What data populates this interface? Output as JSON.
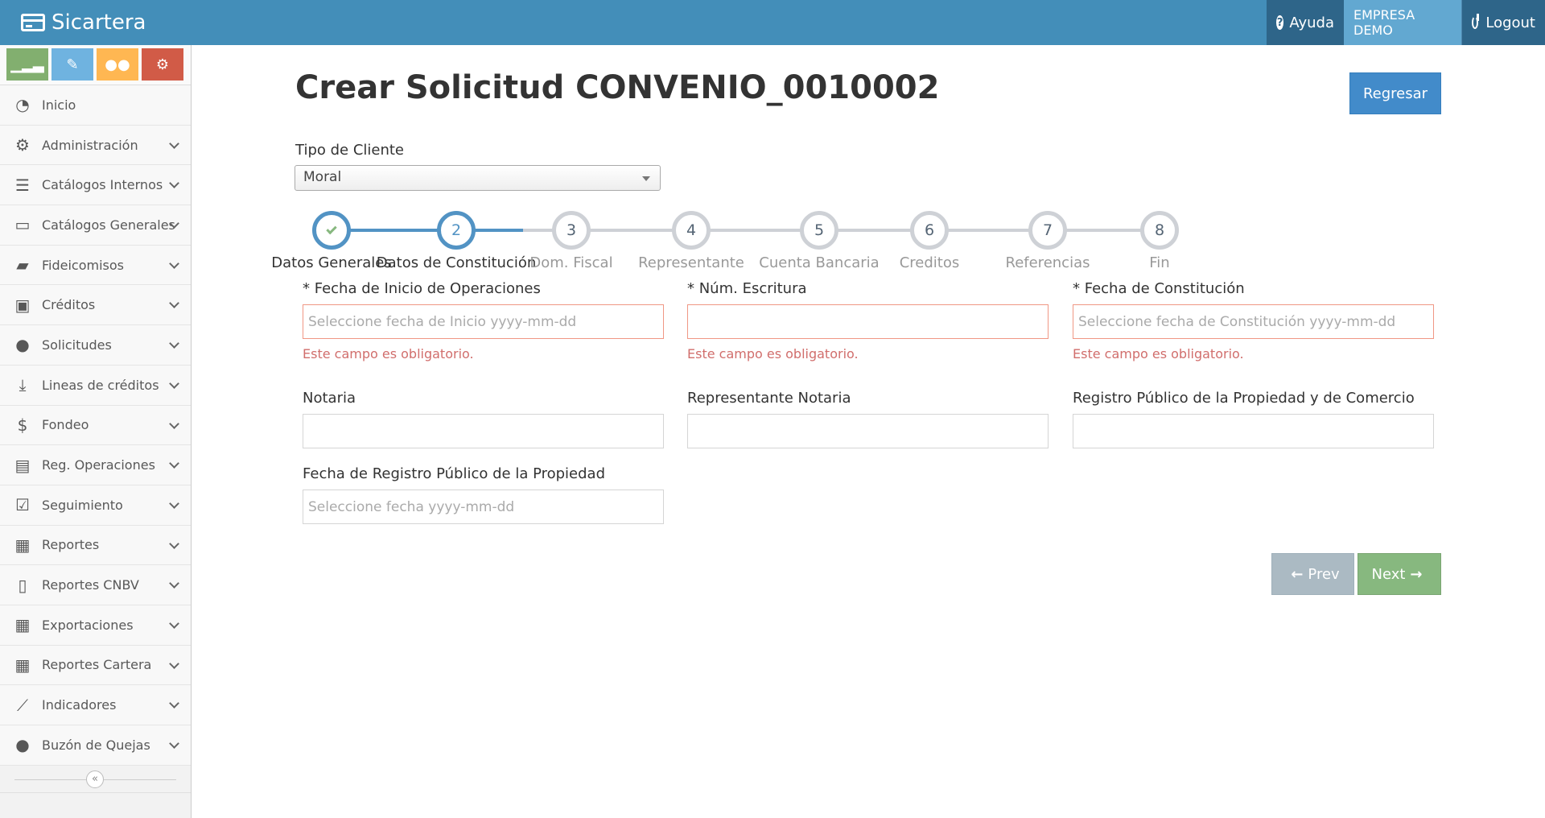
{
  "app": {
    "brand": "Sicartera"
  },
  "topnav": {
    "help": "Ayuda",
    "company": "EMPRESA DEMO",
    "logout": "Logout"
  },
  "sidebar": {
    "items": [
      {
        "label": "Inicio",
        "icon": "dashboard-icon",
        "glyph": "◔"
      },
      {
        "label": "Administración",
        "icon": "cogs-icon",
        "glyph": "⚙"
      },
      {
        "label": "Catálogos Internos",
        "icon": "database-icon",
        "glyph": "☰"
      },
      {
        "label": "Catálogos Generales",
        "icon": "desktop-icon",
        "glyph": "▭"
      },
      {
        "label": "Fideicomisos",
        "icon": "folder-open-icon",
        "glyph": "▰"
      },
      {
        "label": "Créditos",
        "icon": "briefcase-icon",
        "glyph": "▣"
      },
      {
        "label": "Solicitudes",
        "icon": "user-icon",
        "glyph": "●"
      },
      {
        "label": "Lineas de créditos",
        "icon": "download-tray-icon",
        "glyph": "⤓"
      },
      {
        "label": "Fondeo",
        "icon": "dollar-icon",
        "glyph": "$"
      },
      {
        "label": "Reg. Operaciones",
        "icon": "file-text-icon",
        "glyph": "▤"
      },
      {
        "label": "Seguimiento",
        "icon": "check-square-icon",
        "glyph": "☑"
      },
      {
        "label": "Reportes",
        "icon": "file-excel-icon",
        "glyph": "▦"
      },
      {
        "label": "Reportes CNBV",
        "icon": "file-icon",
        "glyph": "▯"
      },
      {
        "label": "Exportaciones",
        "icon": "file-excel-icon",
        "glyph": "▦"
      },
      {
        "label": "Reportes Cartera",
        "icon": "file-excel-icon",
        "glyph": "▦"
      },
      {
        "label": "Indicadores",
        "icon": "line-chart-icon",
        "glyph": "⟋"
      },
      {
        "label": "Buzón de Quejas",
        "icon": "comment-icon",
        "glyph": "●"
      }
    ]
  },
  "page": {
    "title": "Crear Solicitud CONVENIO_0010002",
    "back_button": "Regresar",
    "client_type_label": "Tipo de Cliente",
    "client_type_value": "Moral"
  },
  "steps": [
    {
      "num": "1",
      "label": "Datos Generales",
      "state": "done"
    },
    {
      "num": "2",
      "label": "Datos de Constitución",
      "state": "active"
    },
    {
      "num": "3",
      "label": "Dom. Fiscal",
      "state": "pending"
    },
    {
      "num": "4",
      "label": "Representante",
      "state": "pending"
    },
    {
      "num": "5",
      "label": "Cuenta Bancaria",
      "state": "pending"
    },
    {
      "num": "6",
      "label": "Creditos",
      "state": "pending"
    },
    {
      "num": "7",
      "label": "Referencias",
      "state": "pending"
    },
    {
      "num": "8",
      "label": "Fin",
      "state": "pending"
    }
  ],
  "form": {
    "fecha_inicio": {
      "label": "* Fecha de Inicio de Operaciones",
      "placeholder": "Seleccione fecha de Inicio yyyy-mm-dd",
      "error": "Este campo es obligatorio."
    },
    "num_escritura": {
      "label": "* Núm. Escritura",
      "placeholder": "",
      "error": "Este campo es obligatorio."
    },
    "fecha_constitucion": {
      "label": "* Fecha de Constitución",
      "placeholder": "Seleccione fecha de Constitución yyyy-mm-dd",
      "error": "Este campo es obligatorio."
    },
    "notaria": {
      "label": "Notaria",
      "placeholder": ""
    },
    "representante_notaria": {
      "label": "Representante Notaria",
      "placeholder": ""
    },
    "registro_publico": {
      "label": "Registro Público de la Propiedad y de Comercio",
      "placeholder": ""
    },
    "fecha_registro": {
      "label": "Fecha de Registro Público de la Propiedad",
      "placeholder": "Seleccione fecha  yyyy-mm-dd"
    }
  },
  "wizard_buttons": {
    "prev": "Prev",
    "next": "Next"
  },
  "colors": {
    "topbar": "#438eb9",
    "primary": "#428bca",
    "success": "#87b87f",
    "error": "#d16e6c"
  }
}
